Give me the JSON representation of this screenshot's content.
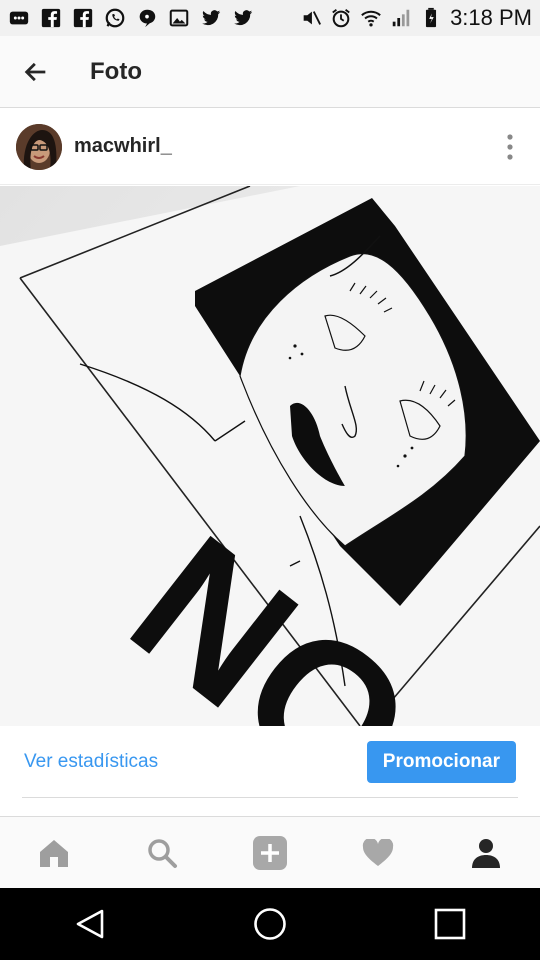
{
  "status_bar": {
    "time": "3:18 PM",
    "icons": [
      "message-icon",
      "facebook-icon",
      "facebook-icon",
      "whatsapp-icon",
      "chat-bubble-icon",
      "gallery-icon",
      "twitter-icon",
      "twitter-icon",
      "mute-icon",
      "alarm-icon",
      "wifi-icon",
      "signal-icon",
      "battery-icon"
    ]
  },
  "header": {
    "title": "Foto",
    "back_icon": "arrow-left-icon"
  },
  "post": {
    "username": "macwhirl_",
    "more_icon": "more-vertical-icon",
    "photo_text": "NO"
  },
  "actions": {
    "stats_label": "Ver estadísticas",
    "promote_label": "Promocionar"
  },
  "tabs": [
    "home-icon",
    "search-icon",
    "add-icon",
    "heart-icon",
    "profile-icon"
  ],
  "nav": [
    "back-triangle-icon",
    "home-circle-icon",
    "recents-square-icon"
  ],
  "colors": {
    "accent": "#3897f0",
    "text": "#262626"
  }
}
